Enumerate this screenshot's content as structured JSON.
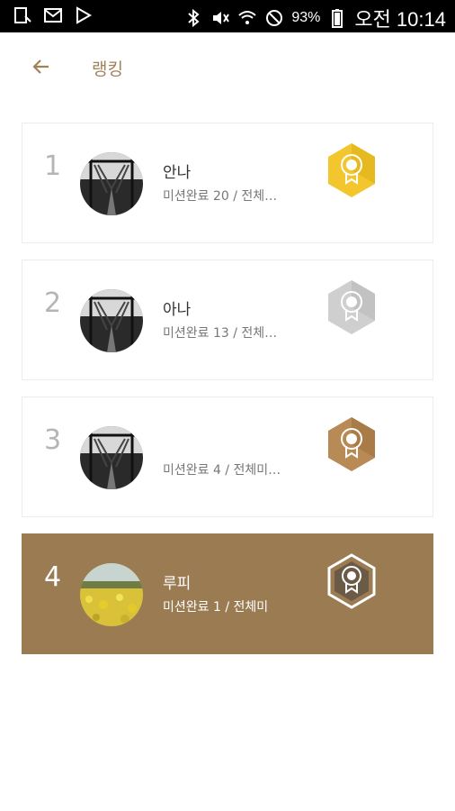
{
  "status_bar": {
    "left_icons": [
      "download-icon",
      "gmail-icon",
      "play-store-icon"
    ],
    "right_icons": [
      "bluetooth-icon",
      "mute-icon",
      "wifi-icon",
      "do-not-disturb-icon"
    ],
    "battery_percent": "93%",
    "time": "오전 10:14"
  },
  "header": {
    "back_icon": "arrow-left-icon",
    "title": "랭킹"
  },
  "ranking": [
    {
      "rank": "1",
      "name": "안나",
      "stats": "미션완료 20 / 전체…",
      "badge": "gold",
      "badge_color": "#f2c62c",
      "highlight": false
    },
    {
      "rank": "2",
      "name": "아나",
      "stats": "미션완료 13 / 전체…",
      "badge": "silver",
      "badge_color": "#c9c9c9",
      "highlight": false
    },
    {
      "rank": "3",
      "name": "",
      "stats": "미션완료 4 / 전체미…",
      "badge": "bronze",
      "badge_color": "#b88a55",
      "highlight": false
    },
    {
      "rank": "4",
      "name": "루피",
      "stats": "미션완료 1 / 전체미",
      "badge": "outline",
      "badge_color": "#ffffff",
      "highlight": true
    }
  ],
  "colors": {
    "accent": "#a0825a",
    "highlight_row": "#9a7b52"
  }
}
